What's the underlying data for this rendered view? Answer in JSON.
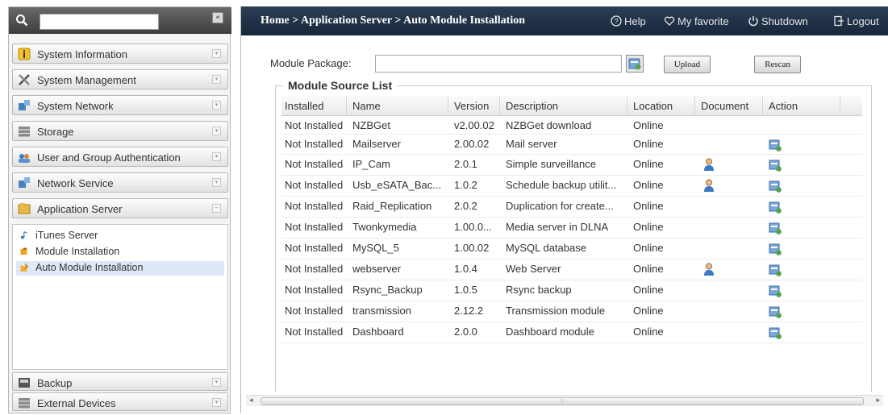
{
  "search": {
    "value": "",
    "collapse_glyph": "«"
  },
  "sidebar": {
    "menus": [
      {
        "label": "System Information",
        "icon": "info-icon"
      },
      {
        "label": "System Management",
        "icon": "tools-icon"
      },
      {
        "label": "System Network",
        "icon": "network-icon"
      },
      {
        "label": "Storage",
        "icon": "storage-icon"
      },
      {
        "label": "User and Group Authentication",
        "icon": "users-icon"
      },
      {
        "label": "Network Service",
        "icon": "network-service-icon"
      },
      {
        "label": "Application Server",
        "icon": "app-server-icon",
        "expanded": true
      }
    ],
    "submenu": [
      {
        "label": "iTunes Server",
        "icon": "itunes-icon"
      },
      {
        "label": "Module Installation",
        "icon": "module-icon"
      },
      {
        "label": "Auto Module Installation",
        "icon": "auto-module-icon",
        "selected": true
      }
    ],
    "bottom_menus": [
      {
        "label": "Backup",
        "icon": "backup-icon"
      },
      {
        "label": "External Devices",
        "icon": "external-devices-icon"
      }
    ]
  },
  "header": {
    "breadcrumb": "Home > Application Server > Auto Module Installation",
    "help": "Help",
    "favorite": "My favorite",
    "shutdown": "Shutdown",
    "logout": "Logout"
  },
  "form": {
    "package_label": "Module Package:",
    "package_value": "",
    "upload": "Upload",
    "rescan": "Rescan"
  },
  "module_list": {
    "legend": "Module Source List",
    "columns": [
      "Installed",
      "Name",
      "Version",
      "Description",
      "Location",
      "Document",
      "Action"
    ],
    "rows": [
      {
        "installed": "Not Installed",
        "name": "NZBGet",
        "version": "v2.00.02",
        "description": "NZBGet download",
        "location": "Online",
        "document": false,
        "action": false
      },
      {
        "installed": "Not Installed",
        "name": "Mailserver",
        "version": "2.00.02",
        "description": "Mail server",
        "location": "Online",
        "document": false,
        "action": true
      },
      {
        "installed": "Not Installed",
        "name": "IP_Cam",
        "version": "2.0.1",
        "description": "Simple surveillance",
        "location": "Online",
        "document": true,
        "action": true
      },
      {
        "installed": "Not Installed",
        "name": "Usb_eSATA_Bac...",
        "version": "1.0.2",
        "description": "Schedule backup utilit...",
        "location": "Online",
        "document": true,
        "action": true
      },
      {
        "installed": "Not Installed",
        "name": "Raid_Replication",
        "version": "2.0.2",
        "description": "Duplication for create...",
        "location": "Online",
        "document": false,
        "action": true
      },
      {
        "installed": "Not Installed",
        "name": "Twonkymedia",
        "version": "1.00.0...",
        "description": "Media server in DLNA",
        "location": "Online",
        "document": false,
        "action": true
      },
      {
        "installed": "Not Installed",
        "name": "MySQL_5",
        "version": "1.00.02",
        "description": "MySQL database",
        "location": "Online",
        "document": false,
        "action": true
      },
      {
        "installed": "Not Installed",
        "name": "webserver",
        "version": "1.0.4",
        "description": "Web Server",
        "location": "Online",
        "document": true,
        "action": true
      },
      {
        "installed": "Not Installed",
        "name": "Rsync_Backup",
        "version": "1.0.5",
        "description": "Rsync backup",
        "location": "Online",
        "document": false,
        "action": true
      },
      {
        "installed": "Not Installed",
        "name": "transmission",
        "version": "2.12.2",
        "description": "Transmission module",
        "location": "Online",
        "document": false,
        "action": true
      },
      {
        "installed": "Not Installed",
        "name": "Dashboard",
        "version": "2.0.0",
        "description": "Dashboard module",
        "location": "Online",
        "document": false,
        "action": true
      }
    ]
  },
  "scrollbar": {
    "left": "◂",
    "right": "▸",
    "grip": "⦙⦙⦙"
  },
  "colors": {
    "header_bg": "#1f3048",
    "selected_row": "#dde9f6",
    "action_icon": "#4a8ccf"
  }
}
